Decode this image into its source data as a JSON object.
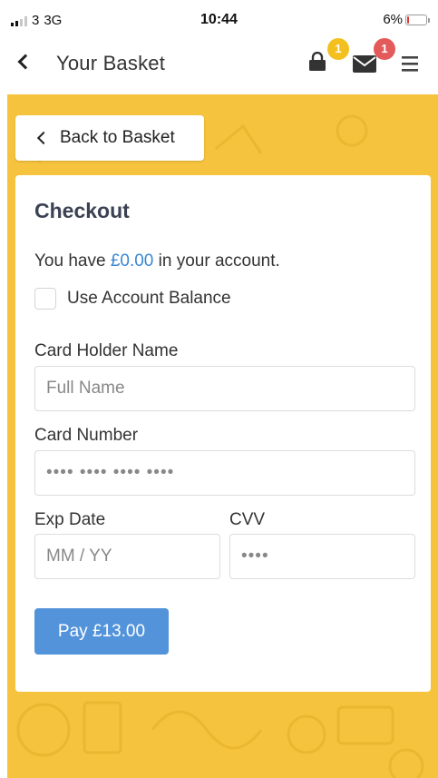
{
  "status_bar": {
    "carrier": "3",
    "network": "3G",
    "time": "10:44",
    "battery": "6%",
    "battery_level": 0.06
  },
  "header": {
    "title": "Your Basket",
    "basket_badge": "1",
    "messages_badge": "1",
    "icons": [
      "chevron-left-icon",
      "lock-icon",
      "envelope-icon",
      "menu-icon"
    ]
  },
  "back_button": {
    "label": "Back to Basket"
  },
  "checkout": {
    "title": "Checkout",
    "balance_prefix": "You have",
    "balance_amount": "£0.00",
    "balance_suffix": "in your account.",
    "use_balance_label": "Use Account Balance",
    "card_holder_label": "Card Holder Name",
    "card_holder_placeholder": "Full Name",
    "card_number_label": "Card Number",
    "card_number_placeholder": "•••• •••• •••• ••••",
    "exp_label": "Exp Date",
    "exp_placeholder": "MM / YY",
    "cvv_label": "CVV",
    "cvv_placeholder": "••••",
    "pay_label": "Pay £13.00"
  },
  "colors": {
    "background_yellow": "#f5c33d",
    "accent_blue": "#5293da",
    "badge_yellow": "#f4c020",
    "badge_red": "#e35a5a"
  }
}
